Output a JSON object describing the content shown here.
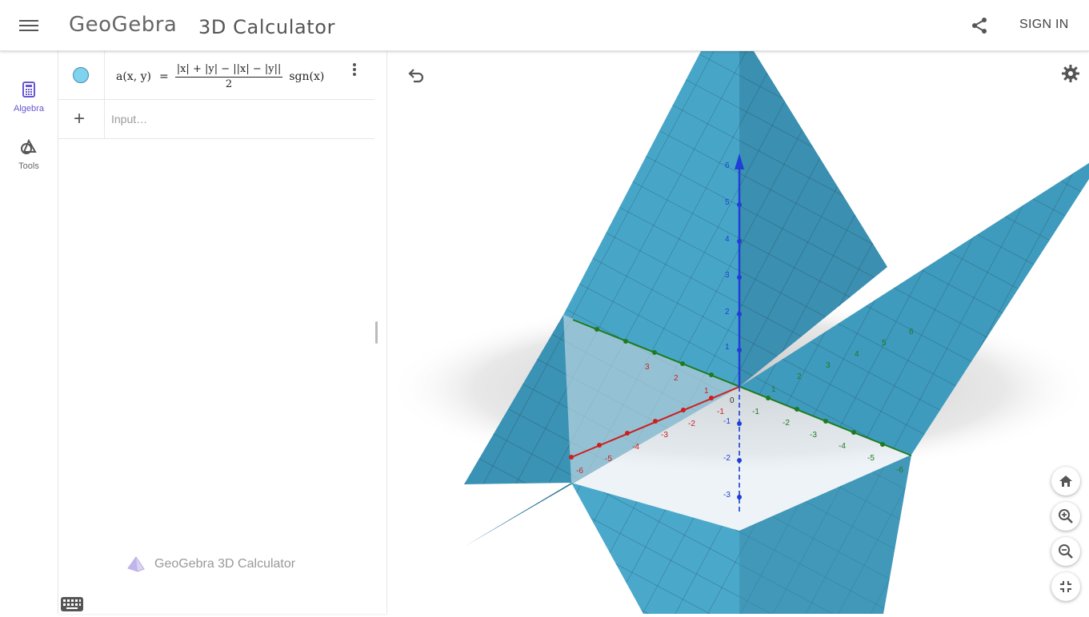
{
  "header": {
    "logo_text": "GeoGebra",
    "app_title": "3D Calculator",
    "share_icon": "share-icon",
    "sign_in_label": "SIGN IN"
  },
  "rail": {
    "items": [
      {
        "label": "Algebra",
        "icon": "calculator-icon",
        "active": true
      },
      {
        "label": "Tools",
        "icon": "tools-icon",
        "active": false
      }
    ]
  },
  "algebra": {
    "expression": {
      "lhs": "a(x, y)",
      "equals": "=",
      "numerator": "|x| + |y| − ||x| − |y||",
      "denominator": "2",
      "tail": "sgn(x)",
      "color": "#7ed3ef"
    },
    "input_placeholder": "Input…",
    "footer_brand": "GeoGebra 3D Calculator"
  },
  "graphics": {
    "x_axis_color": "#cc1f1f",
    "y_axis_color": "#1f7a1f",
    "z_axis_color": "#1f3fd6",
    "surface_color": "#3ea7cc",
    "origin_label": "0",
    "x_ticks": [
      "-1",
      "-2",
      "-3",
      "-4",
      "-5",
      "-6",
      "1",
      "2",
      "3"
    ],
    "y_ticks": [
      "1",
      "2",
      "3",
      "4",
      "5",
      "6",
      "-1",
      "-2",
      "-3",
      "-4",
      "-5",
      "-6"
    ],
    "z_ticks": [
      "1",
      "2",
      "3",
      "4",
      "5",
      "6",
      "-1",
      "-2",
      "-3"
    ]
  },
  "controls": {
    "undo_icon": "undo-icon",
    "settings_icon": "gear-icon",
    "home_icon": "home-icon",
    "zoom_in_icon": "zoom-in-icon",
    "zoom_out_icon": "zoom-out-icon",
    "fullscreen_exit_icon": "fullscreen-exit-icon"
  }
}
